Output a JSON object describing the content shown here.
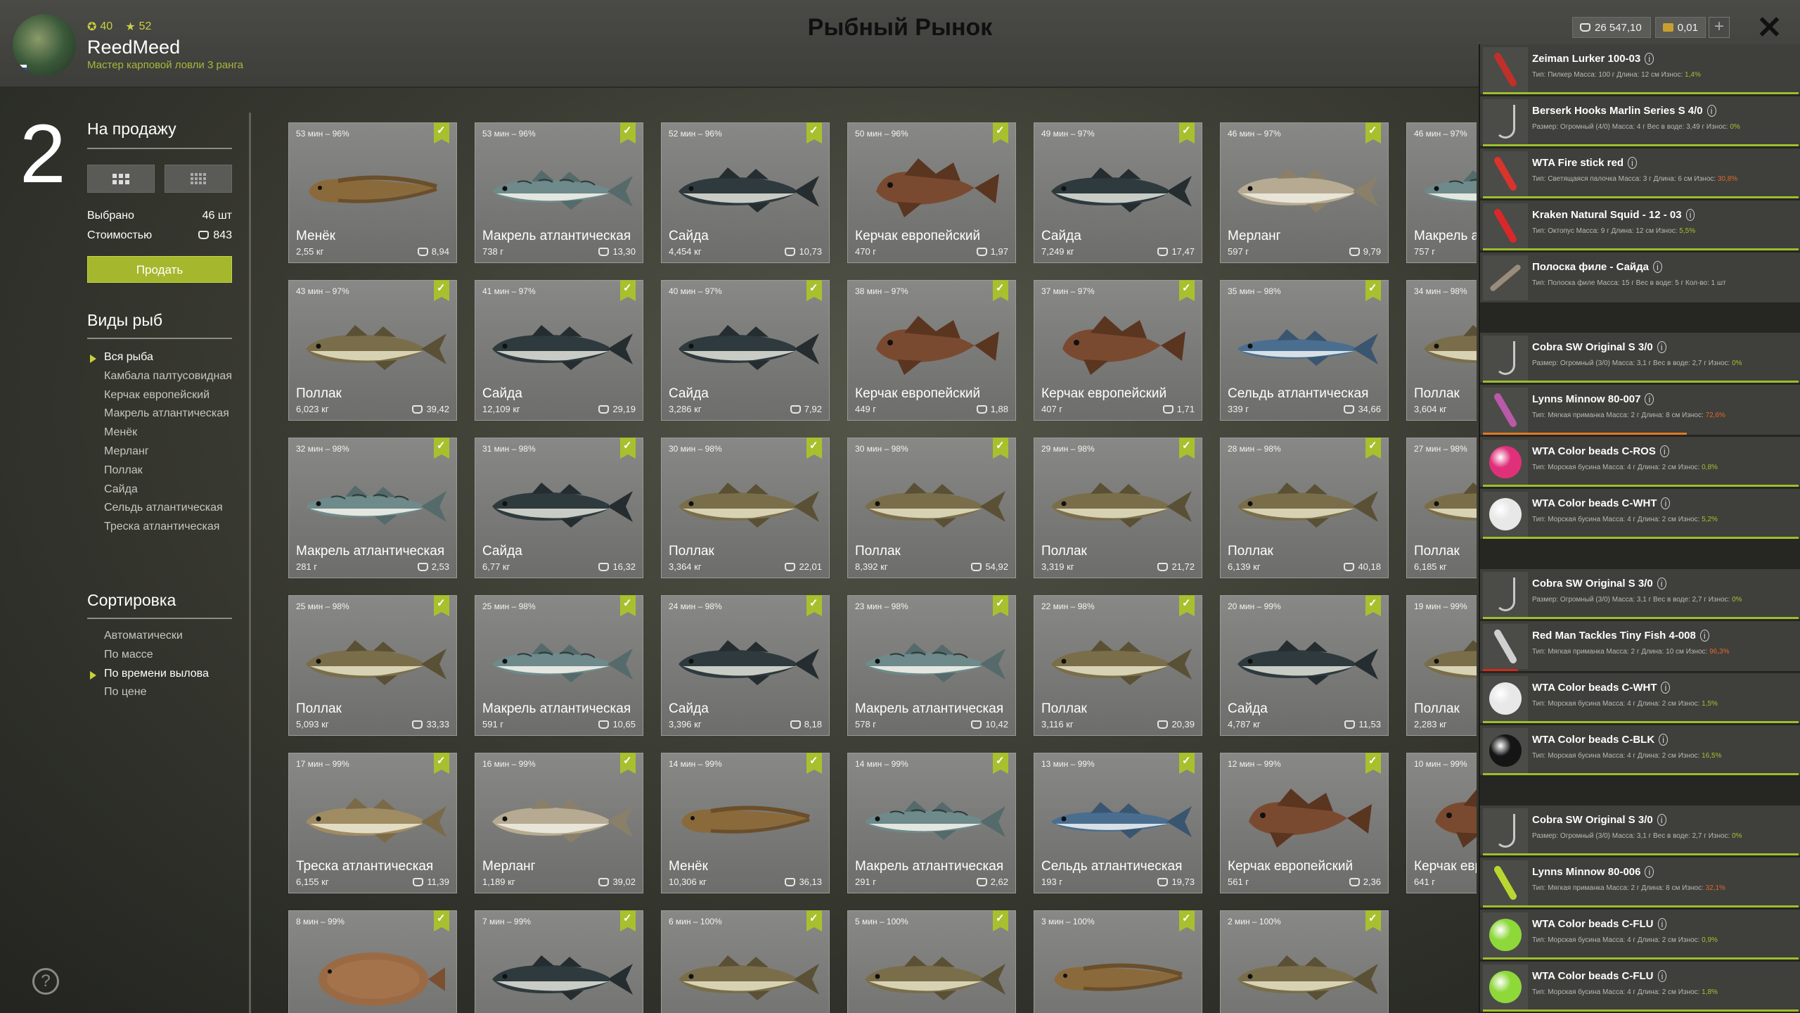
{
  "header": {
    "title": "Рыбный Рынок",
    "username": "ReedMeed",
    "rank": "Мастер карповой ловли 3 ранга",
    "stat_level": "40",
    "stat_stars": "52",
    "money": "26 547,10",
    "gold": "0,01",
    "plus": "+",
    "close": "✕"
  },
  "left": {
    "count": "2",
    "sale_title": "На продажу",
    "selected_label": "Выбрано",
    "selected_value": "46 шт",
    "cost_label": "Стоимостью",
    "cost_value": "843",
    "sell_button": "Продать",
    "species_title": "Виды рыб",
    "species": [
      {
        "label": "Вся рыба",
        "active": true
      },
      {
        "label": "Камбала палтусовидная",
        "active": false
      },
      {
        "label": "Керчак европейский",
        "active": false
      },
      {
        "label": "Макрель атлантическая",
        "active": false
      },
      {
        "label": "Менёк",
        "active": false
      },
      {
        "label": "Мерланг",
        "active": false
      },
      {
        "label": "Поллак",
        "active": false
      },
      {
        "label": "Сайда",
        "active": false
      },
      {
        "label": "Сельдь атлантическая",
        "active": false
      },
      {
        "label": "Треска атлантическая",
        "active": false
      }
    ],
    "sort_title": "Сортировка",
    "sort_options": [
      {
        "label": "Автоматически",
        "active": false
      },
      {
        "label": "По массе",
        "active": false
      },
      {
        "label": "По времени вылова",
        "active": true
      },
      {
        "label": "По цене",
        "active": false
      }
    ],
    "help": "?"
  },
  "fish": [
    {
      "time": "53 мин – 96%",
      "name": "Менёк",
      "weight": "2,55 кг",
      "price": "8,94",
      "kind": "cusk"
    },
    {
      "time": "53 мин – 96%",
      "name": "Макрель атлантическая",
      "weight": "738 г",
      "price": "13,30",
      "kind": "mackerel"
    },
    {
      "time": "52 мин – 96%",
      "name": "Сайда",
      "weight": "4,454 кг",
      "price": "10,73",
      "kind": "saithe"
    },
    {
      "time": "50 мин – 96%",
      "name": "Керчак европейский",
      "weight": "470 г",
      "price": "1,97",
      "kind": "sculpin"
    },
    {
      "time": "49 мин – 97%",
      "name": "Сайда",
      "weight": "7,249 кг",
      "price": "17,47",
      "kind": "saithe"
    },
    {
      "time": "46 мин – 97%",
      "name": "Мерланг",
      "weight": "597 г",
      "price": "9,79",
      "kind": "whiting"
    },
    {
      "time": "46 мин – 97%",
      "name": "Макрель атлантическая",
      "weight": "757 г",
      "price": "",
      "kind": "mackerel"
    },
    {
      "time": "43 мин – 97%",
      "name": "Поллак",
      "weight": "6,023 кг",
      "price": "39,42",
      "kind": "pollack"
    },
    {
      "time": "41 мин – 97%",
      "name": "Сайда",
      "weight": "12,109 кг",
      "price": "29,19",
      "kind": "saithe"
    },
    {
      "time": "40 мин – 97%",
      "name": "Сайда",
      "weight": "3,286 кг",
      "price": "7,92",
      "kind": "saithe"
    },
    {
      "time": "38 мин – 97%",
      "name": "Керчак европейский",
      "weight": "449 г",
      "price": "1,88",
      "kind": "sculpin"
    },
    {
      "time": "37 мин – 97%",
      "name": "Керчак европейский",
      "weight": "407 г",
      "price": "1,71",
      "kind": "sculpin"
    },
    {
      "time": "35 мин – 98%",
      "name": "Сельдь атлантическая",
      "weight": "339 г",
      "price": "34,66",
      "kind": "herring"
    },
    {
      "time": "34 мин – 98%",
      "name": "Поллак",
      "weight": "3,604 кг",
      "price": "",
      "kind": "pollack"
    },
    {
      "time": "32 мин – 98%",
      "name": "Макрель атлантическая",
      "weight": "281 г",
      "price": "2,53",
      "kind": "mackerel"
    },
    {
      "time": "31 мин – 98%",
      "name": "Сайда",
      "weight": "6,77 кг",
      "price": "16,32",
      "kind": "saithe"
    },
    {
      "time": "30 мин – 98%",
      "name": "Поллак",
      "weight": "3,364 кг",
      "price": "22,01",
      "kind": "pollack"
    },
    {
      "time": "30 мин – 98%",
      "name": "Поллак",
      "weight": "8,392 кг",
      "price": "54,92",
      "kind": "pollack"
    },
    {
      "time": "29 мин – 98%",
      "name": "Поллак",
      "weight": "3,319 кг",
      "price": "21,72",
      "kind": "pollack"
    },
    {
      "time": "28 мин – 98%",
      "name": "Поллак",
      "weight": "6,139 кг",
      "price": "40,18",
      "kind": "pollack"
    },
    {
      "time": "27 мин – 98%",
      "name": "Поллак",
      "weight": "6,185 кг",
      "price": "",
      "kind": "pollack"
    },
    {
      "time": "25 мин – 98%",
      "name": "Поллак",
      "weight": "5,093 кг",
      "price": "33,33",
      "kind": "pollack"
    },
    {
      "time": "25 мин – 98%",
      "name": "Макрель атлантическая",
      "weight": "591 г",
      "price": "10,65",
      "kind": "mackerel"
    },
    {
      "time": "24 мин – 98%",
      "name": "Сайда",
      "weight": "3,396 кг",
      "price": "8,18",
      "kind": "saithe"
    },
    {
      "time": "23 мин – 98%",
      "name": "Макрель атлантическая",
      "weight": "578 г",
      "price": "10,42",
      "kind": "mackerel"
    },
    {
      "time": "22 мин – 98%",
      "name": "Поллак",
      "weight": "3,116 кг",
      "price": "20,39",
      "kind": "pollack"
    },
    {
      "time": "20 мин – 99%",
      "name": "Сайда",
      "weight": "4,787 кг",
      "price": "11,53",
      "kind": "saithe"
    },
    {
      "time": "19 мин – 99%",
      "name": "Поллак",
      "weight": "2,283 кг",
      "price": "",
      "kind": "pollack"
    },
    {
      "time": "17 мин – 99%",
      "name": "Треска атлантическая",
      "weight": "6,155 кг",
      "price": "11,39",
      "kind": "cod"
    },
    {
      "time": "16 мин – 99%",
      "name": "Мерланг",
      "weight": "1,189 кг",
      "price": "39,02",
      "kind": "whiting"
    },
    {
      "time": "14 мин – 99%",
      "name": "Менёк",
      "weight": "10,306 кг",
      "price": "36,13",
      "kind": "cusk"
    },
    {
      "time": "14 мин – 99%",
      "name": "Макрель атлантическая",
      "weight": "291 г",
      "price": "2,62",
      "kind": "mackerel"
    },
    {
      "time": "13 мин – 99%",
      "name": "Сельдь атлантическая",
      "weight": "193 г",
      "price": "19,73",
      "kind": "herring"
    },
    {
      "time": "12 мин – 99%",
      "name": "Керчак европейский",
      "weight": "561 г",
      "price": "2,36",
      "kind": "sculpin"
    },
    {
      "time": "10 мин – 99%",
      "name": "Керчак европейский",
      "weight": "641 г",
      "price": "",
      "kind": "sculpin"
    },
    {
      "time": "8 мин – 99%",
      "name": "",
      "weight": "",
      "price": "",
      "kind": "flounder"
    },
    {
      "time": "7 мин – 99%",
      "name": "",
      "weight": "",
      "price": "",
      "kind": "saithe"
    },
    {
      "time": "6 мин – 100%",
      "name": "",
      "weight": "",
      "price": "",
      "kind": "pollack"
    },
    {
      "time": "5 мин – 100%",
      "name": "",
      "weight": "",
      "price": "",
      "kind": "pollack"
    },
    {
      "time": "3 мин – 100%",
      "name": "",
      "weight": "",
      "price": "",
      "kind": "cusk"
    },
    {
      "time": "2 мин – 100%",
      "name": "",
      "weight": "",
      "price": "",
      "kind": "pollack"
    }
  ],
  "equipment": [
    {
      "name": "Zeiman Lurker 100-03",
      "detail": "Тип: Пилкер  Масса: 100 г  Длина: 12 см  Износ: ",
      "wear": "1,4%",
      "icon": "jig-icon",
      "color": "#c0302a",
      "bar": "green"
    },
    {
      "name": "Berserk Hooks Marlin Series S 4/0",
      "detail": "Размер: Огромный (4/0)  Масса: 4 г  Вес в воде: 3,49 г  Износ: ",
      "wear": "0%",
      "icon": "hook-icon",
      "color": "#c8c8c8",
      "bar": "green"
    },
    {
      "name": "WTA Fire stick red",
      "detail": "Тип: Светящаяся палочка  Масса: 3 г  Длина: 6 см  Износ: ",
      "wear": "30,8%",
      "icon": "glow-stick-icon",
      "color": "#d8342c",
      "bar": "green",
      "wear_bad": true
    },
    {
      "name": "Kraken Natural Squid - 12 - 03",
      "detail": "Тип: Октопус  Масса: 9 г  Длина: 12 см  Износ: ",
      "wear": "5,5%",
      "icon": "squid-icon",
      "color": "#d8282a",
      "bar": "green"
    },
    {
      "name": "Полоска филе - Сайда",
      "detail": "Тип: Полоска филе  Масса: 15 г  Вес в воде: 5 г  Кол-во: 1 шт",
      "wear": "",
      "icon": "fillet-icon",
      "color": "#9a8c7a",
      "bar": "none"
    },
    {
      "name": "Cobra SW Original S 3/0",
      "detail": "Размер: Огромный (3/0)  Масса: 3,1 г  Вес в воде: 2,7 г  Износ: ",
      "wear": "0%",
      "icon": "hook-icon",
      "color": "#c8c8c8",
      "bar": "green"
    },
    {
      "name": "Lynns Minnow 80-007",
      "detail": "Тип: Мягкая приманка  Масса: 2 г  Длина: 8 см  Износ: ",
      "wear": "72,6%",
      "icon": "soft-bait-icon",
      "color": "#b85aa8",
      "bar": "orange",
      "wear_bad": true
    },
    {
      "name": "WTA Color beads C-ROS",
      "detail": "Тип: Морская бусина  Масса: 4 г  Длина: 2 см  Износ: ",
      "wear": "0,8%",
      "icon": "bead-icon",
      "color": "#e0307a",
      "bar": "green"
    },
    {
      "name": "WTA Color beads C-WHT",
      "detail": "Тип: Морская бусина  Масса: 4 г  Длина: 2 см  Износ: ",
      "wear": "5,2%",
      "icon": "bead-icon",
      "color": "#e8e8e8",
      "bar": "green"
    },
    {
      "name": "Cobra SW Original S 3/0",
      "detail": "Размер: Огромный (3/0)  Масса: 3,1 г  Вес в воде: 2,7 г  Износ: ",
      "wear": "0%",
      "icon": "hook-icon",
      "color": "#c8c8c8",
      "bar": "green"
    },
    {
      "name": "Red Man Tackles Tiny Fish 4-008",
      "detail": "Тип: Мягкая приманка  Масса: 2 г  Длина: 10 см  Износ: ",
      "wear": "96,3%",
      "icon": "soft-bait-icon",
      "color": "#d0d0d0",
      "bar": "red",
      "wear_bad": true
    },
    {
      "name": "WTA Color beads C-WHT",
      "detail": "Тип: Морская бусина  Масса: 4 г  Длина: 2 см  Износ: ",
      "wear": "1,5%",
      "icon": "bead-icon",
      "color": "#e8e8e8",
      "bar": "green"
    },
    {
      "name": "WTA Color beads C-BLK",
      "detail": "Тип: Морская бусина  Масса: 4 г  Длина: 2 см  Износ: ",
      "wear": "16,5%",
      "icon": "bead-icon",
      "color": "#151515",
      "bar": "green"
    },
    {
      "name": "Cobra SW Original S 3/0",
      "detail": "Размер: Огромный (3/0)  Масса: 3,1 г  Вес в воде: 2,7 г  Износ: ",
      "wear": "0%",
      "icon": "hook-icon",
      "color": "#c8c8c8",
      "bar": "green"
    },
    {
      "name": "Lynns Minnow 80-006",
      "detail": "Тип: Мягкая приманка  Масса: 2 г  Длина: 8 см  Износ: ",
      "wear": "32,1%",
      "icon": "soft-bait-icon",
      "color": "#b8d830",
      "bar": "green",
      "wear_bad": true
    },
    {
      "name": "WTA Color beads C-FLU",
      "detail": "Тип: Морская бусина  Масса: 4 г  Длина: 2 см  Износ: ",
      "wear": "0,9%",
      "icon": "bead-icon",
      "color": "#8ed83a",
      "bar": "green"
    },
    {
      "name": "WTA Color beads C-FLU",
      "detail": "Тип: Морская бусина  Масса: 4 г  Длина: 2 см  Износ: ",
      "wear": "1,8%",
      "icon": "bead-icon",
      "color": "#8ed83a",
      "bar": "green"
    }
  ],
  "fish_colors": {
    "cusk": {
      "body": "#8a6a3a",
      "belly": "#b89a60",
      "fin": "#6b4f2a"
    },
    "mackerel": {
      "body": "#6e8a8a",
      "belly": "#e4e6e0",
      "fin": "#556a6a"
    },
    "saithe": {
      "body": "#2e3a3e",
      "belly": "#c8ccc4",
      "fin": "#252d30"
    },
    "sculpin": {
      "body": "#7a4a30",
      "belly": "#a8704a",
      "fin": "#5a3520"
    },
    "whiting": {
      "body": "#b6ab92",
      "belly": "#e8e4d8",
      "fin": "#8a806a"
    },
    "pollack": {
      "body": "#7a6e4a",
      "belly": "#d8d2b4",
      "fin": "#5a5035"
    },
    "herring": {
      "body": "#4a6e90",
      "belly": "#d8e0e6",
      "fin": "#3a5570"
    },
    "cod": {
      "body": "#a08c62",
      "belly": "#e2dcc4",
      "fin": "#7a6a48"
    },
    "flounder": {
      "body": "#9a6a44",
      "belly": "#b88258",
      "fin": "#7a5030"
    }
  }
}
